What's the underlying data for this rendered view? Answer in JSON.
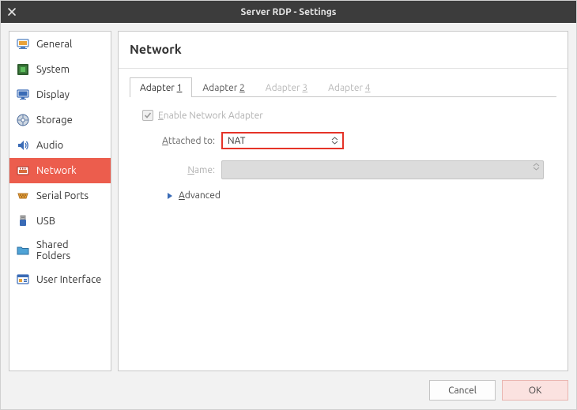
{
  "window": {
    "title": "Server RDP - Settings"
  },
  "sidebar": {
    "items": [
      {
        "key": "general",
        "label": "General"
      },
      {
        "key": "system",
        "label": "System"
      },
      {
        "key": "display",
        "label": "Display"
      },
      {
        "key": "storage",
        "label": "Storage"
      },
      {
        "key": "audio",
        "label": "Audio"
      },
      {
        "key": "network",
        "label": "Network",
        "selected": true
      },
      {
        "key": "serial-ports",
        "label": "Serial Ports"
      },
      {
        "key": "usb",
        "label": "USB"
      },
      {
        "key": "shared-folders",
        "label": "Shared Folders"
      },
      {
        "key": "user-interface",
        "label": "User Interface"
      }
    ]
  },
  "page": {
    "title": "Network"
  },
  "tabs": [
    {
      "prefix": "Adapter ",
      "num": "1",
      "state": "active"
    },
    {
      "prefix": "Adapter ",
      "num": "2",
      "state": "available"
    },
    {
      "prefix": "Adapter ",
      "num": "3",
      "state": "disabled"
    },
    {
      "prefix": "Adapter ",
      "num": "4",
      "state": "disabled"
    }
  ],
  "form": {
    "enable_checkbox": {
      "label_prefix": "E",
      "label_rest": "nable Network Adapter",
      "checked": true,
      "disabled": true
    },
    "attached_to": {
      "label_prefix": "A",
      "label_rest": "ttached to:",
      "value": "NAT"
    },
    "name": {
      "label_prefix": "N",
      "label_rest": "ame:",
      "value": "",
      "disabled": true
    },
    "advanced": {
      "label_prefix": "A",
      "label_rest": "dvanced"
    }
  },
  "footer": {
    "cancel": "Cancel",
    "ok": "OK"
  }
}
